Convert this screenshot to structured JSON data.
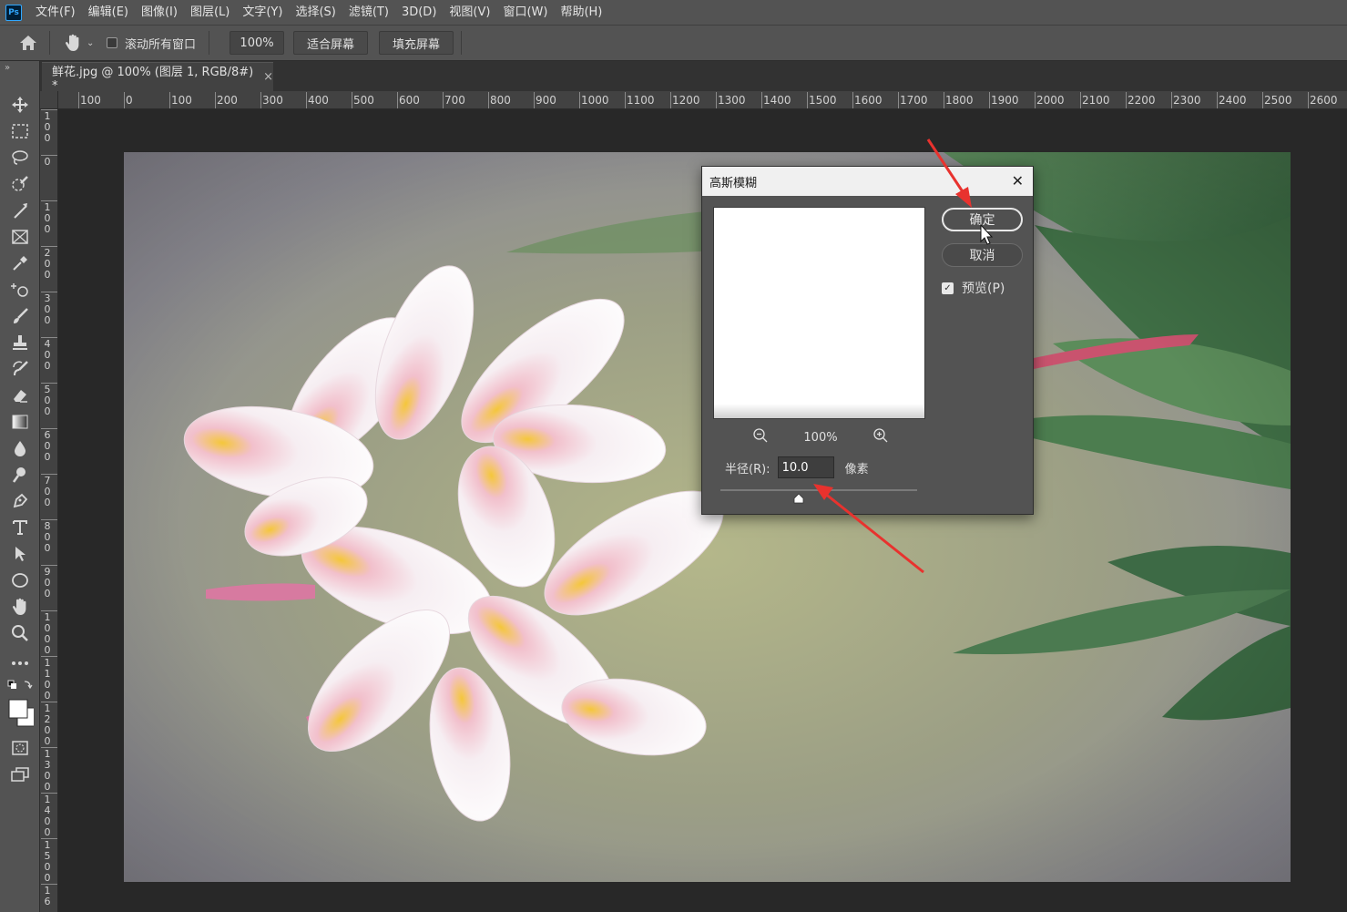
{
  "app": {
    "logo_text": "Ps"
  },
  "menu": [
    "文件(F)",
    "编辑(E)",
    "图像(I)",
    "图层(L)",
    "文字(Y)",
    "选择(S)",
    "滤镜(T)",
    "3D(D)",
    "视图(V)",
    "窗口(W)",
    "帮助(H)"
  ],
  "options_bar": {
    "scroll_all_label": "滚动所有窗口",
    "zoom_value": "100%",
    "fit_screen_label": "适合屏幕",
    "fill_screen_label": "填充屏幕"
  },
  "tab": {
    "title": "鲜花.jpg @ 100% (图层 1, RGB/8#) *",
    "close": "×"
  },
  "ruler_top_labels": [
    "100",
    "0",
    "100",
    "200",
    "300",
    "400",
    "500",
    "600",
    "700",
    "800",
    "900",
    "1000",
    "1100",
    "1200",
    "1300",
    "1400",
    "1500",
    "1600",
    "1700",
    "1800",
    "1900",
    "2000",
    "2100",
    "2200",
    "2300",
    "2400",
    "2500",
    "2600"
  ],
  "ruler_left_labels": [
    "100",
    "0",
    "100",
    "200",
    "300",
    "400",
    "500",
    "600",
    "700",
    "800",
    "900",
    "1000",
    "1100",
    "1200",
    "1300",
    "1400",
    "1500",
    "16"
  ],
  "dialog": {
    "title": "高斯模糊",
    "close": "✕",
    "ok_label": "确定",
    "cancel_label": "取消",
    "preview_label": "预览(P)",
    "preview_checked": true,
    "zoom_pct": "100%",
    "radius_label": "半径(R):",
    "radius_value": "10.0",
    "radius_unit": "像素"
  },
  "colors": {
    "annotation_arrow": "#e8322e",
    "ps_blue": "#31a8ff"
  }
}
